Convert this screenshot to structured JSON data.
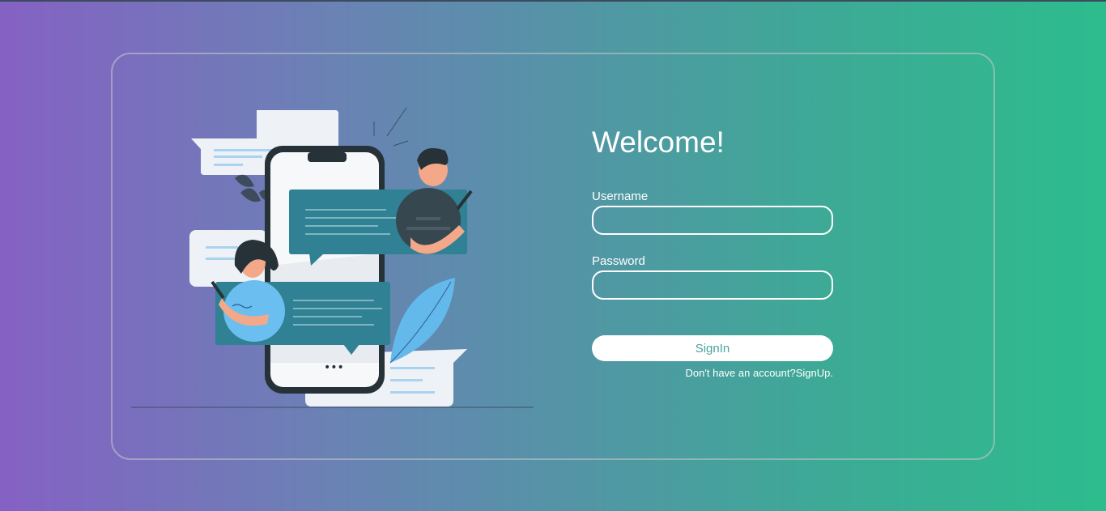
{
  "login": {
    "title": "Welcome!",
    "username_label": "Username",
    "username_value": "",
    "password_label": "Password",
    "password_value": "",
    "signin_label": "SignIn",
    "signup_prompt": "Don't have an account?",
    "signup_link": "SignUp."
  },
  "illustration": {
    "icon": "chat-phone-illustration",
    "ellipsis": "•••"
  },
  "colors": {
    "gradient_start": "#8561c4",
    "gradient_end": "#2dbc8d",
    "button_text": "#4aa39f"
  }
}
